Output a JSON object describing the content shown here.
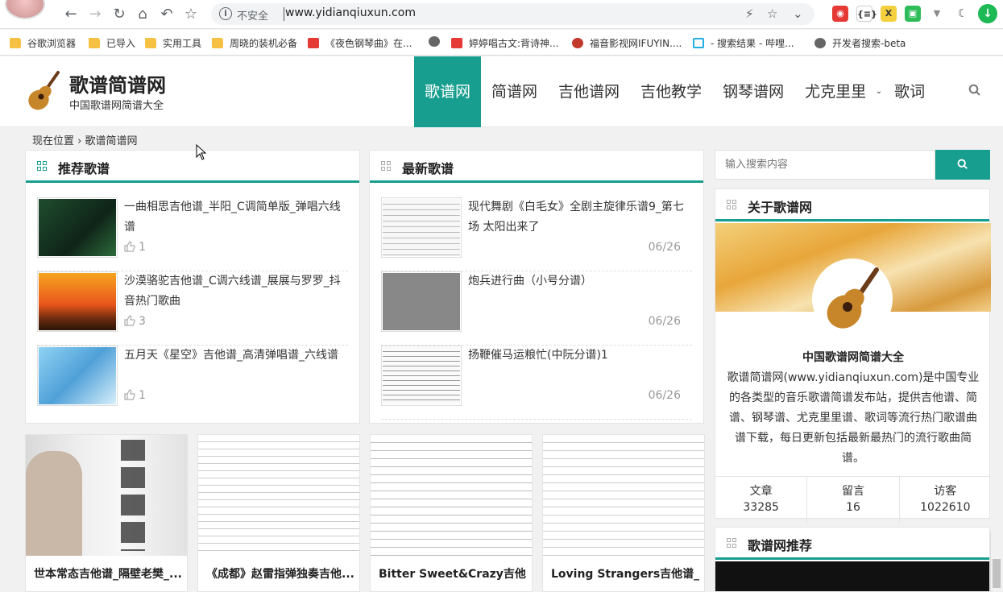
{
  "browser": {
    "omnibox_security": "不安全",
    "url": "www.yidianqiuxun.com",
    "icons": [
      "back-icon",
      "forward-icon",
      "reload-icon",
      "home-icon",
      "undo-icon",
      "star-icon"
    ]
  },
  "bookmarks": [
    {
      "label": "谷歌浏览器",
      "icon": "folder"
    },
    {
      "label": "已导入",
      "icon": "folder"
    },
    {
      "label": "实用工具",
      "icon": "folder"
    },
    {
      "label": "周晓的装机必备",
      "icon": "folder"
    },
    {
      "label": "《夜色钢琴曲》在...",
      "icon": "ting"
    },
    {
      "label": "",
      "icon": "globe"
    },
    {
      "label": "婷婷唱古文:背诗神...",
      "icon": "ting"
    },
    {
      "label": "福音影视网IFUYIN....",
      "icon": "fuyin"
    },
    {
      "label": "- 搜索结果 - 哔哩...",
      "icon": "bili"
    },
    {
      "label": "开发者搜索-beta",
      "icon": "globe"
    }
  ],
  "site": {
    "title": "歌谱简谱网",
    "subtitle": "中国歌谱网简谱大全",
    "nav": [
      "歌谱网",
      "简谱网",
      "吉他谱网",
      "吉他教学",
      "钢琴谱网",
      "尤克里里",
      "歌词"
    ],
    "breadcrumb": "现在位置 › 歌谱简谱网",
    "accent": "#189e8e"
  },
  "recommended": {
    "title": "推荐歌谱",
    "items": [
      {
        "title": "一曲相思吉他谱_半阳_C调简单版_弹唱六线谱",
        "likes": "1"
      },
      {
        "title": "沙漠骆驼吉他谱_C调六线谱_展展与罗罗_抖音热门歌曲",
        "likes": "3"
      },
      {
        "title": "五月天《星空》吉他谱_高清弹唱谱_六线谱",
        "likes": "1"
      }
    ]
  },
  "latest": {
    "title": "最新歌谱",
    "items": [
      {
        "title": "现代舞剧《白毛女》全剧主旋律乐谱9_第七场 太阳出来了",
        "date": "06/26"
      },
      {
        "title": "炮兵进行曲（小号分谱）",
        "date": "06/26"
      },
      {
        "title": "扬鞭催马运粮忙(中阮分谱)1",
        "date": "06/26"
      }
    ]
  },
  "cards": [
    {
      "title": "世本常态吉他谱_隔壁老樊_..."
    },
    {
      "title": "《成都》赵雷指弹独奏吉他..."
    },
    {
      "title": "Bitter Sweet&Crazy吉他..."
    },
    {
      "title": "Loving Strangers吉他谱_..."
    }
  ],
  "sidebar": {
    "search_placeholder": "输入搜索内容",
    "about_title": "关于歌谱网",
    "about_name": "中国歌谱网简谱大全",
    "about_desc": "歌谱简谱网(www.yidianqiuxun.com)是中国专业的各类型的音乐歌谱简谱发布站，提供吉他谱、简谱、钢琴谱、尤克里里谱、歌词等流行热门歌谱曲谱下载，每日更新包括最新最热门的流行歌曲简谱。",
    "stats": [
      {
        "label": "文章",
        "value": "33285"
      },
      {
        "label": "留言",
        "value": "16"
      },
      {
        "label": "访客",
        "value": "1022610"
      }
    ],
    "rec_title": "歌谱网推荐"
  }
}
